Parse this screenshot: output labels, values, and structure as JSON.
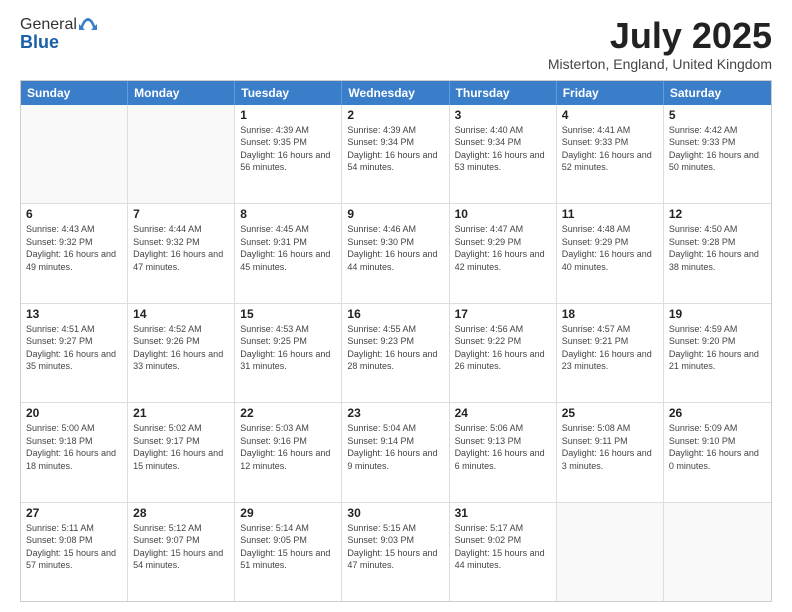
{
  "logo": {
    "general": "General",
    "blue": "Blue"
  },
  "title": "July 2025",
  "subtitle": "Misterton, England, United Kingdom",
  "calendar": {
    "headers": [
      "Sunday",
      "Monday",
      "Tuesday",
      "Wednesday",
      "Thursday",
      "Friday",
      "Saturday"
    ],
    "weeks": [
      [
        {
          "day": "",
          "info": ""
        },
        {
          "day": "",
          "info": ""
        },
        {
          "day": "1",
          "info": "Sunrise: 4:39 AM\nSunset: 9:35 PM\nDaylight: 16 hours and 56 minutes."
        },
        {
          "day": "2",
          "info": "Sunrise: 4:39 AM\nSunset: 9:34 PM\nDaylight: 16 hours and 54 minutes."
        },
        {
          "day": "3",
          "info": "Sunrise: 4:40 AM\nSunset: 9:34 PM\nDaylight: 16 hours and 53 minutes."
        },
        {
          "day": "4",
          "info": "Sunrise: 4:41 AM\nSunset: 9:33 PM\nDaylight: 16 hours and 52 minutes."
        },
        {
          "day": "5",
          "info": "Sunrise: 4:42 AM\nSunset: 9:33 PM\nDaylight: 16 hours and 50 minutes."
        }
      ],
      [
        {
          "day": "6",
          "info": "Sunrise: 4:43 AM\nSunset: 9:32 PM\nDaylight: 16 hours and 49 minutes."
        },
        {
          "day": "7",
          "info": "Sunrise: 4:44 AM\nSunset: 9:32 PM\nDaylight: 16 hours and 47 minutes."
        },
        {
          "day": "8",
          "info": "Sunrise: 4:45 AM\nSunset: 9:31 PM\nDaylight: 16 hours and 45 minutes."
        },
        {
          "day": "9",
          "info": "Sunrise: 4:46 AM\nSunset: 9:30 PM\nDaylight: 16 hours and 44 minutes."
        },
        {
          "day": "10",
          "info": "Sunrise: 4:47 AM\nSunset: 9:29 PM\nDaylight: 16 hours and 42 minutes."
        },
        {
          "day": "11",
          "info": "Sunrise: 4:48 AM\nSunset: 9:29 PM\nDaylight: 16 hours and 40 minutes."
        },
        {
          "day": "12",
          "info": "Sunrise: 4:50 AM\nSunset: 9:28 PM\nDaylight: 16 hours and 38 minutes."
        }
      ],
      [
        {
          "day": "13",
          "info": "Sunrise: 4:51 AM\nSunset: 9:27 PM\nDaylight: 16 hours and 35 minutes."
        },
        {
          "day": "14",
          "info": "Sunrise: 4:52 AM\nSunset: 9:26 PM\nDaylight: 16 hours and 33 minutes."
        },
        {
          "day": "15",
          "info": "Sunrise: 4:53 AM\nSunset: 9:25 PM\nDaylight: 16 hours and 31 minutes."
        },
        {
          "day": "16",
          "info": "Sunrise: 4:55 AM\nSunset: 9:23 PM\nDaylight: 16 hours and 28 minutes."
        },
        {
          "day": "17",
          "info": "Sunrise: 4:56 AM\nSunset: 9:22 PM\nDaylight: 16 hours and 26 minutes."
        },
        {
          "day": "18",
          "info": "Sunrise: 4:57 AM\nSunset: 9:21 PM\nDaylight: 16 hours and 23 minutes."
        },
        {
          "day": "19",
          "info": "Sunrise: 4:59 AM\nSunset: 9:20 PM\nDaylight: 16 hours and 21 minutes."
        }
      ],
      [
        {
          "day": "20",
          "info": "Sunrise: 5:00 AM\nSunset: 9:18 PM\nDaylight: 16 hours and 18 minutes."
        },
        {
          "day": "21",
          "info": "Sunrise: 5:02 AM\nSunset: 9:17 PM\nDaylight: 16 hours and 15 minutes."
        },
        {
          "day": "22",
          "info": "Sunrise: 5:03 AM\nSunset: 9:16 PM\nDaylight: 16 hours and 12 minutes."
        },
        {
          "day": "23",
          "info": "Sunrise: 5:04 AM\nSunset: 9:14 PM\nDaylight: 16 hours and 9 minutes."
        },
        {
          "day": "24",
          "info": "Sunrise: 5:06 AM\nSunset: 9:13 PM\nDaylight: 16 hours and 6 minutes."
        },
        {
          "day": "25",
          "info": "Sunrise: 5:08 AM\nSunset: 9:11 PM\nDaylight: 16 hours and 3 minutes."
        },
        {
          "day": "26",
          "info": "Sunrise: 5:09 AM\nSunset: 9:10 PM\nDaylight: 16 hours and 0 minutes."
        }
      ],
      [
        {
          "day": "27",
          "info": "Sunrise: 5:11 AM\nSunset: 9:08 PM\nDaylight: 15 hours and 57 minutes."
        },
        {
          "day": "28",
          "info": "Sunrise: 5:12 AM\nSunset: 9:07 PM\nDaylight: 15 hours and 54 minutes."
        },
        {
          "day": "29",
          "info": "Sunrise: 5:14 AM\nSunset: 9:05 PM\nDaylight: 15 hours and 51 minutes."
        },
        {
          "day": "30",
          "info": "Sunrise: 5:15 AM\nSunset: 9:03 PM\nDaylight: 15 hours and 47 minutes."
        },
        {
          "day": "31",
          "info": "Sunrise: 5:17 AM\nSunset: 9:02 PM\nDaylight: 15 hours and 44 minutes."
        },
        {
          "day": "",
          "info": ""
        },
        {
          "day": "",
          "info": ""
        }
      ]
    ]
  }
}
